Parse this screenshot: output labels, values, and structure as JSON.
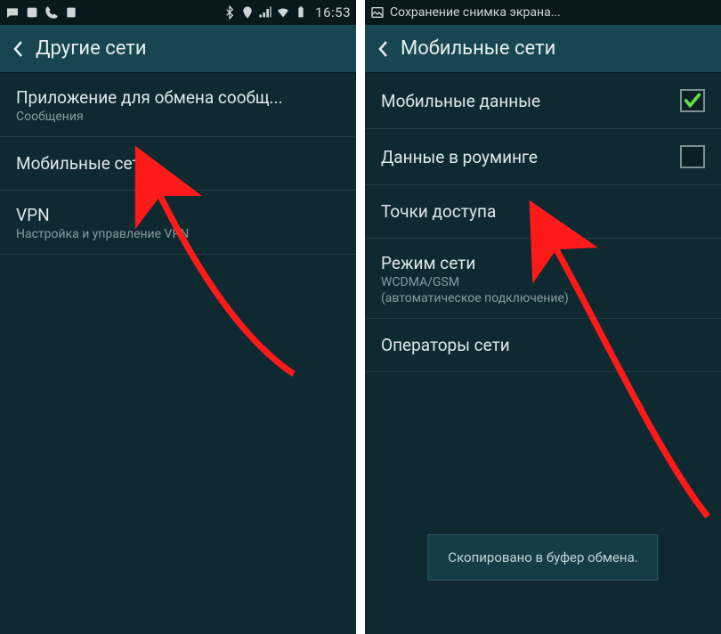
{
  "left": {
    "status": {
      "time": "16:53"
    },
    "header": {
      "title": "Другие сети"
    },
    "items": [
      {
        "title": "Приложение для обмена сообщ...",
        "sub": "Сообщения"
      },
      {
        "title": "Мобильные сети"
      },
      {
        "title": "VPN",
        "sub": "Настройка и управление VPN"
      }
    ]
  },
  "right": {
    "status": {
      "notif": "Сохранение снимка экрана..."
    },
    "header": {
      "title": "Мобильные сети"
    },
    "items": [
      {
        "title": "Мобильные данные",
        "checked": true
      },
      {
        "title": "Данные в роуминге",
        "checked": false
      },
      {
        "title": "Точки доступа"
      },
      {
        "title": "Режим сети",
        "sub": "WCDMA/GSM",
        "sub2": "(автоматическое подключение)"
      },
      {
        "title": "Операторы сети"
      }
    ],
    "toast": "Скопировано в буфер обмена."
  }
}
